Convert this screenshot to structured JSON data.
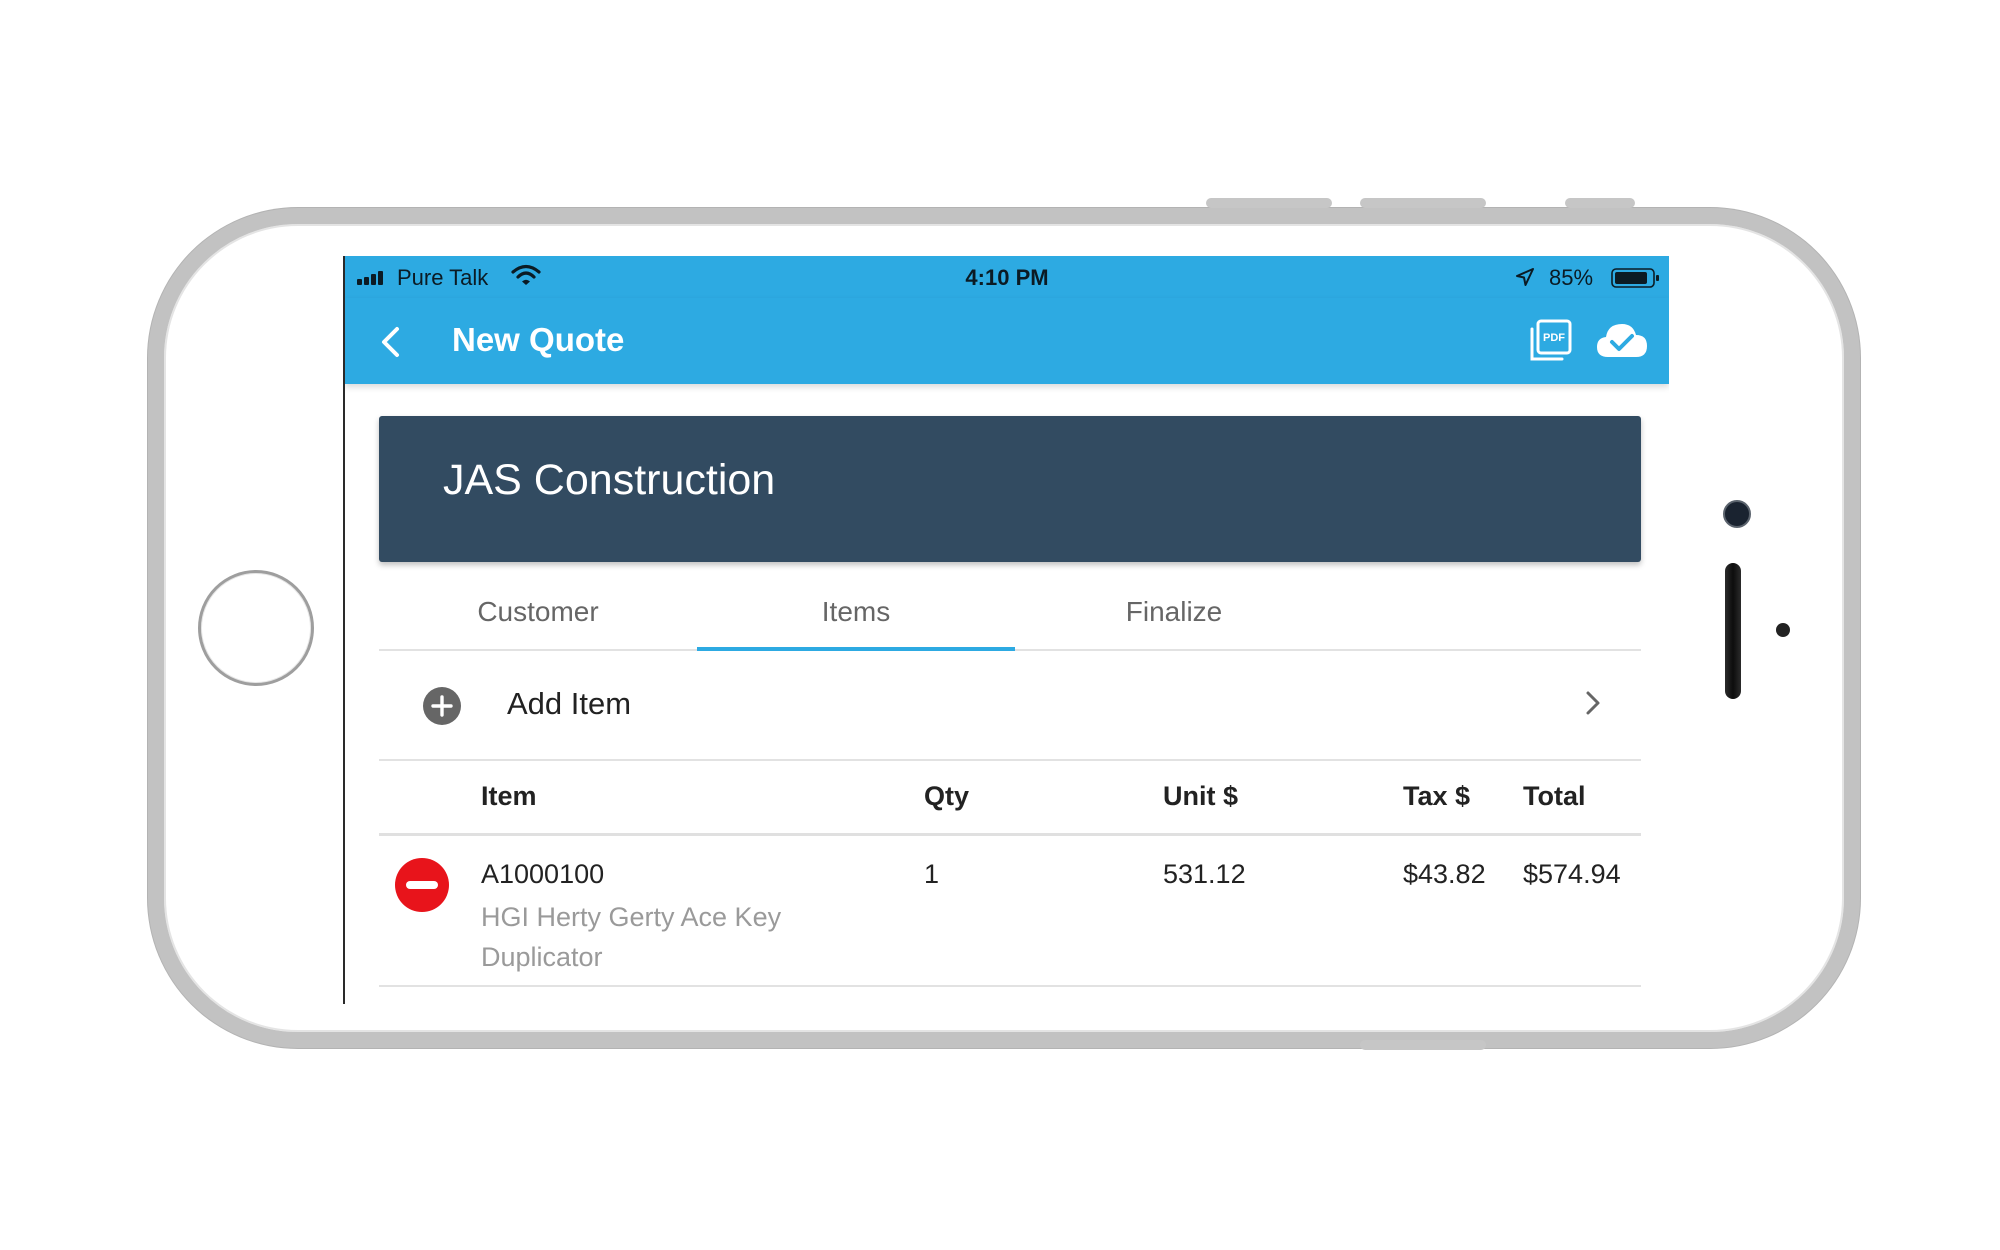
{
  "status_bar": {
    "carrier": "Pure Talk",
    "time": "4:10 PM",
    "battery": "85%"
  },
  "nav": {
    "title": "New Quote",
    "pdf_icon": "pdf-icon",
    "sync_icon": "cloud-check-icon"
  },
  "header": {
    "company": "JAS Construction"
  },
  "tabs": [
    {
      "label": "Customer"
    },
    {
      "label": "Items",
      "active": true
    },
    {
      "label": "Finalize"
    }
  ],
  "add_item": {
    "label": "Add Item"
  },
  "table": {
    "columns": [
      "Item",
      "Qty",
      "Unit $",
      "Tax $",
      "Total"
    ],
    "rows": [
      {
        "sku": "A1000100",
        "description": "HGI Herty Gerty Ace Key Duplicator",
        "qty": "1",
        "unit": "531.12",
        "tax": "$43.82",
        "total": "$574.94"
      }
    ]
  },
  "colors": {
    "accent": "#2daae2",
    "header_bg": "#324b61",
    "remove": "#e8141b"
  }
}
